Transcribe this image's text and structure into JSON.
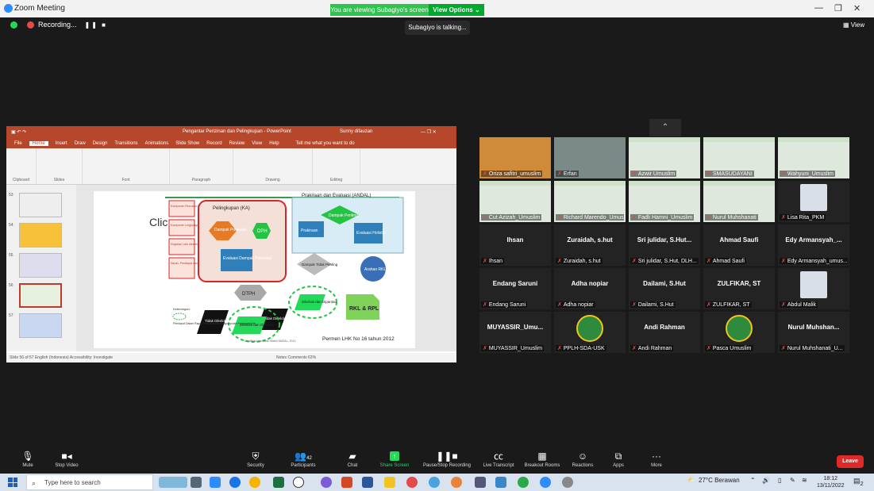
{
  "window": {
    "title": "Zoom Meeting",
    "viewing_banner": "You are viewing Subagiyo's screen",
    "view_options": "View Options ⌄",
    "view_button": "View"
  },
  "recording": {
    "label": "Recording...",
    "controls": "❚❚ ■"
  },
  "talking": "Subagiyo is talking...",
  "ppt": {
    "title": "Pengantar Perizinan dan Pelingkupan - PowerPoint",
    "warning": "Sunny difauzan",
    "tell_me": "Tell me what you want to do",
    "tabs": [
      "File",
      "Home",
      "Insert",
      "Draw",
      "Design",
      "Transitions",
      "Animations",
      "Slide Show",
      "Record",
      "Review",
      "View",
      "Help"
    ],
    "active_tab": "Home",
    "ribbon_groups": [
      "Clipboard",
      "Slides",
      "Font",
      "Paragraph",
      "Drawing",
      "Editing"
    ],
    "thumb_numbers": [
      "53",
      "54",
      "55",
      "56",
      "57"
    ],
    "status_left": "Slide 56 of 57    English (Indonesia)    Accessibility: Investigate",
    "status_right": "Notes   Comments   63%",
    "slide": {
      "click_text": "Clic",
      "ka_title": "Pelingkupan (KA)",
      "andal_title": "Prakiraan dan Evaluasi (ANDAL)",
      "left_boxes": [
        "Komponen Rencana Kegiatan",
        "Komponen Lingkungan Hidup",
        "Kegiatan Lain disekitarnya",
        "Saran, Pendapat dan Tanggapan (SPT) Masyarakat"
      ],
      "dampak_potensial": "Dampak Potensial",
      "dph": "DPH",
      "evaluasi_dampak": "Evaluasi Dampak Potensial",
      "dtph": "DTPH",
      "prakiraan": "Prakiraan",
      "dampak_penting": "Dampak Penting",
      "evaluasi_holistik": "Evaluasi Holistik",
      "dampak_tidak_penting": "Dampak Tidak Penting",
      "arahan": "Arahan RKL-RPL",
      "tidak_dikelola_1": "Tidak Dikelola dan Dipantau",
      "tidak_dikelola_2": "Tidak Dikelola dan Dipantau",
      "dikelola_1": "Dikelola dan Dipantau",
      "dikelola_2": "Dikelola dan Dipantau",
      "rkl": "RKL & RPL",
      "keterangan": "Keterangan:",
      "legend_text": "Pendapat Dalam Rapat Pembahasan Pengumpulan Pendapat Ahli",
      "permen": "Permen LHK No 16 tahun 2012",
      "source": "Modifikasi dari Slide Materi AMDAL, 2013"
    }
  },
  "gallery": [
    {
      "name": "Oriza safitri_umuslim",
      "kind": "video1"
    },
    {
      "name": "Erfan",
      "kind": "video2"
    },
    {
      "name": "Azwir Umuslim",
      "kind": "slide"
    },
    {
      "name": "SMASUDAYANI",
      "kind": "slide"
    },
    {
      "name": "Wahyuni_Umuslim",
      "kind": "slide"
    },
    {
      "name": "Cut Azizah_Umuslim",
      "kind": "slide"
    },
    {
      "name": "Richard Marendo_Umuslim",
      "kind": "slide"
    },
    {
      "name": "Fadli Hamni_Umuslim",
      "kind": "slide"
    },
    {
      "name": "Nurul Muhshanati",
      "kind": "slide"
    },
    {
      "name": "Lisa Rita_PKM",
      "kind": "avatar"
    },
    {
      "name": "Ihsan",
      "big": "Ihsan",
      "kind": "text"
    },
    {
      "name": "Zuraidah, s.hut",
      "big": "Zuraidah, s.hut",
      "kind": "text"
    },
    {
      "name": "Sri julidar, S.Hut, DLH...",
      "big": "Sri julidar, S.Hut...",
      "kind": "text"
    },
    {
      "name": "Ahmad Saufi",
      "big": "Ahmad Saufi",
      "kind": "text"
    },
    {
      "name": "Edy Armansyah_umus...",
      "big": "Edy Armansyah_...",
      "kind": "text"
    },
    {
      "name": "Endang Saruni",
      "big": "Endang Saruni",
      "kind": "text"
    },
    {
      "name": "Adha nopiar",
      "big": "Adha nopiar",
      "kind": "text"
    },
    {
      "name": "Dailami, S.Hut",
      "big": "Dailami, S.Hut",
      "kind": "text"
    },
    {
      "name": "ZULFIKAR, ST",
      "big": "ZULFIKAR, ST",
      "kind": "text"
    },
    {
      "name": "Abdul Malik",
      "kind": "avatar"
    },
    {
      "name": "MUYASSIR_Umuslim",
      "big": "MUYASSIR_Umu...",
      "kind": "text"
    },
    {
      "name": "PPLH-SDA-USK",
      "kind": "logo"
    },
    {
      "name": "Andi Rahman",
      "big": "Andi Rahman",
      "kind": "text"
    },
    {
      "name": "Pasca Umuslim",
      "kind": "logo"
    },
    {
      "name": "Nurul Muhshanati_U...",
      "big": "Nurul Muhshan...",
      "kind": "text"
    }
  ],
  "toolbar": {
    "mute": "Mute",
    "stop_video": "Stop Video",
    "security": "Security",
    "participants": "Participants",
    "participant_count": "42",
    "chat": "Chat",
    "share": "Share Screen",
    "pause_rec": "Pause/Stop Recording",
    "transcript": "Live Transcript",
    "breakout": "Breakout Rooms",
    "reactions": "Reactions",
    "apps": "Apps",
    "more": "More",
    "leave": "Leave"
  },
  "taskbar": {
    "search_placeholder": "Type here to search",
    "weather": "27°C  Berawan",
    "time": "18:12",
    "date": "13/11/2022",
    "notif": "2"
  },
  "colors": {
    "zoom_green": "#23d959",
    "ppt_red": "#b7472a",
    "leave_red": "#e02828"
  }
}
